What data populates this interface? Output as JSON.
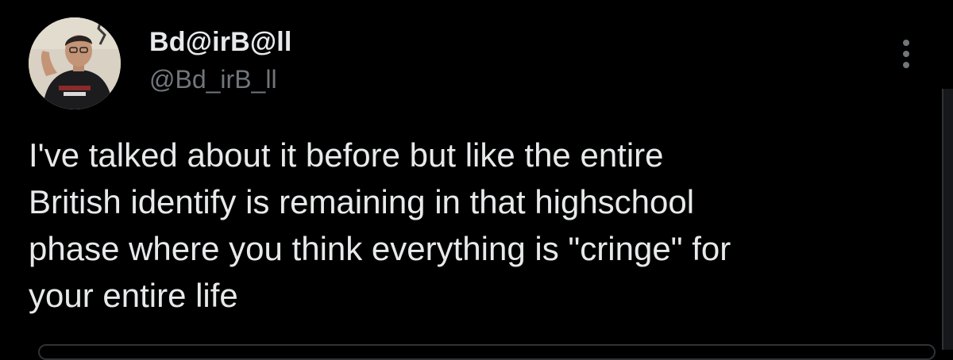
{
  "tweet": {
    "author": {
      "display_name": "Bd@irB@ll",
      "handle": "@Bd_irB_ll",
      "avatar_icon": "user-avatar-photo"
    },
    "more_icon": "more-options-icon",
    "text": "I've talked about it before but like the entire\nBritish identify is remaining in that highschool\nphase where you think everything is \"cringe\" for\nyour entire life"
  },
  "colors": {
    "background": "#000000",
    "primary_text": "#e7e9ea",
    "secondary_text": "#71767b"
  }
}
